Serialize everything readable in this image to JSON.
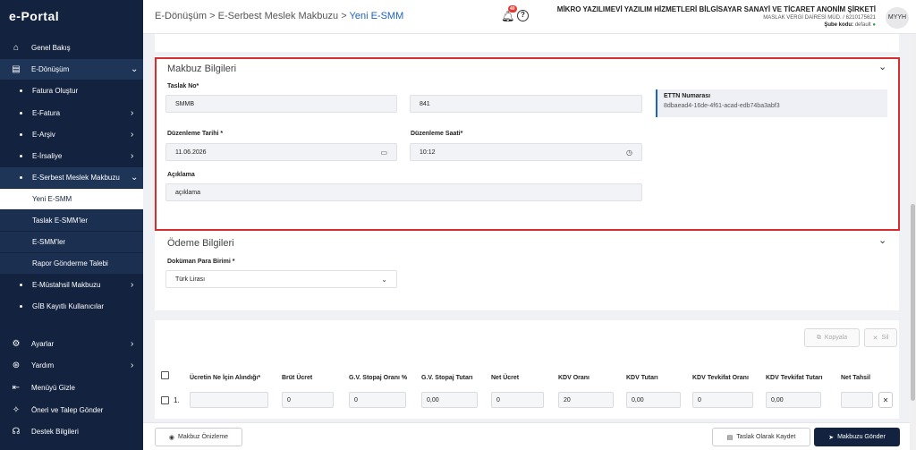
{
  "app": {
    "logo": "e-Portal"
  },
  "sidebar": {
    "items": [
      {
        "label": "Genel Bakış",
        "icon": "home-icon",
        "type": "top"
      },
      {
        "label": "E-Dönüşüm",
        "icon": "document-icon",
        "type": "top-open"
      },
      {
        "label": "Fatura Oluştur",
        "type": "sub"
      },
      {
        "label": "E-Fatura",
        "type": "sub",
        "chevron": "›"
      },
      {
        "label": "E-Arşiv",
        "type": "sub",
        "chevron": "›"
      },
      {
        "label": "E-İrsaliye",
        "type": "sub",
        "chevron": "›"
      },
      {
        "label": "E-Serbest Meslek Makbuzu",
        "type": "sub-open",
        "chevron": "⌄"
      },
      {
        "label": "Yeni E-SMM",
        "type": "subsub-selected"
      },
      {
        "label": "Taslak E-SMM'ler",
        "type": "subsub"
      },
      {
        "label": "E-SMM'ler",
        "type": "subsub"
      },
      {
        "label": "Rapor Gönderme Talebi",
        "type": "subsub"
      },
      {
        "label": "E-Müstahsil Makbuzu",
        "type": "sub",
        "chevron": "›"
      },
      {
        "label": "GİB Kayıtlı Kullanıcılar",
        "type": "sub"
      },
      {
        "label": "Ayarlar",
        "icon": "gear-icon",
        "type": "top",
        "chevron": "›"
      },
      {
        "label": "Yardım",
        "icon": "lifebuoy-icon",
        "type": "top",
        "chevron": "›"
      },
      {
        "label": "Menüyü Gizle",
        "icon": "collapse-icon",
        "type": "top"
      },
      {
        "label": "Öneri ve Talep Gönder",
        "icon": "lightbulb-icon",
        "type": "top"
      },
      {
        "label": "Destek Bilgileri",
        "icon": "support-icon",
        "type": "top"
      }
    ]
  },
  "header": {
    "breadcrumb": [
      "E-Dönüşüm",
      "E-Serbest Meslek Makbuzu",
      "Yeni E-SMM"
    ],
    "sep": ">",
    "notif_count": "40",
    "help": "?",
    "company_name": "MİKRO YAZILIMEVİ YAZILIM HİZMETLERİ BİLGİSAYAR SANAYİ VE TİCARET ANONİM ŞİRKETİ",
    "tax_office": "MASLAK VERGİ DAİRESİ MÜD. / 6210175621",
    "branch_label": "Şube kodu:",
    "branch_value": "default",
    "avatar": "MYYH"
  },
  "receipt": {
    "title": "Makbuz Bilgileri",
    "draft_label": "Taslak No*",
    "draft_prefix": "SMMB",
    "draft_number": "841",
    "ettn_label": "ETTN Numarası",
    "ettn_value": "8dbaead4-16de-4f61-acad-edb74ba3abf3",
    "date_label": "Düzenleme Tarihi *",
    "date_value": "11.06.2026",
    "time_label": "Düzenleme Saati*",
    "time_value": "10:12",
    "desc_label": "Açıklama",
    "desc_value": "açıklama"
  },
  "payment": {
    "title": "Ödeme Bilgileri",
    "currency_label": "Doküman Para Birimi *",
    "currency_value": "Türk Lirası"
  },
  "table": {
    "copy_btn": "Kopyala",
    "delete_btn": "Sil",
    "headers": [
      "Ücretin Ne İçin Alındığı*",
      "Brüt Ücret",
      "G.V. Stopaj Oranı %",
      "G.V. Stopaj Tutarı",
      "Net Ücret",
      "KDV Oranı",
      "KDV Tutarı",
      "KDV Tevkifat Oranı",
      "KDV Tevkifat Tutarı",
      "Net Tahsil"
    ],
    "row": {
      "index": "1.",
      "cells": [
        "",
        "0",
        "0",
        "0,00",
        "0",
        "20",
        "0,00",
        "0",
        "0,00",
        ""
      ]
    }
  },
  "footer": {
    "preview_btn": "Makbuz Önizleme",
    "save_draft_btn": "Taslak Olarak Kaydet",
    "send_btn": "Makbuzu Gönder"
  },
  "colors": {
    "sidebar": "#13233f",
    "accent": "#1c62c4",
    "highlight": "#d92c2c"
  }
}
